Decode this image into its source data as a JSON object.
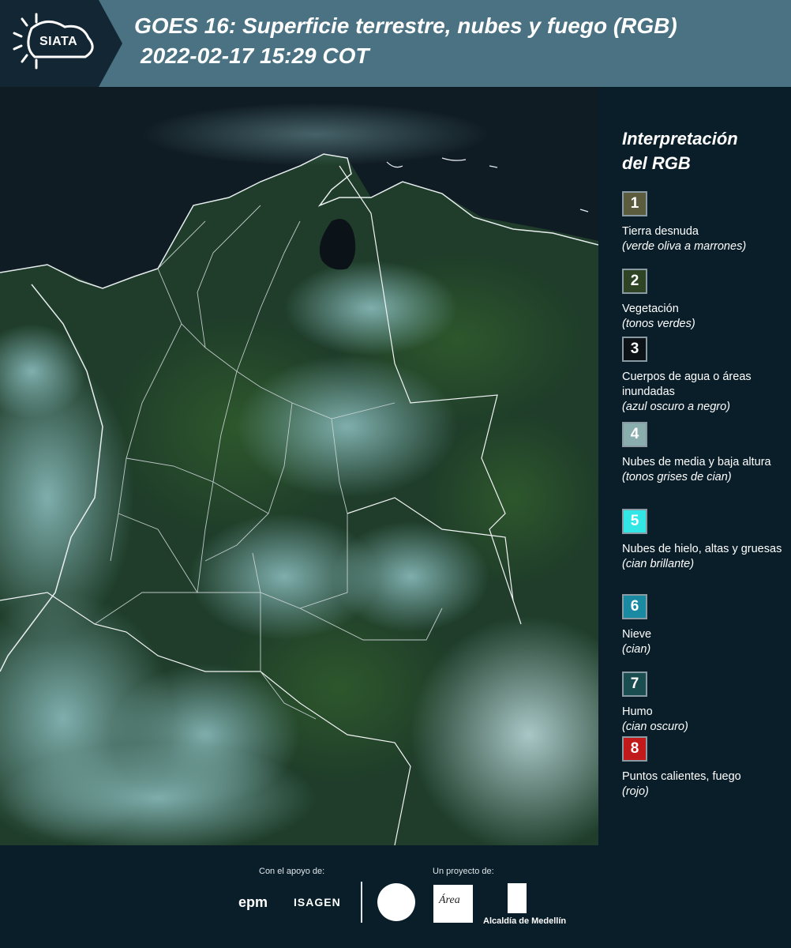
{
  "header": {
    "logo_text": "SIATA",
    "title_line1": "GOES 16: Superficie terrestre, nubes y fuego (RGB)",
    "title_line2": "2022-02-17 15:29 COT"
  },
  "legend": {
    "title_line1": "Interpretación",
    "title_line2": "del RGB",
    "items": [
      {
        "number": "1",
        "label": "Tierra desnuda",
        "note": "(verde oliva a marrones)",
        "color": "#5b5b3e"
      },
      {
        "number": "2",
        "label": "Vegetación",
        "note": "(tonos verdes)",
        "color": "#2e4424"
      },
      {
        "number": "3",
        "label": "Cuerpos de agua o áreas inundadas",
        "note": "(azul oscuro a negro)",
        "color": "#0d1216"
      },
      {
        "number": "4",
        "label": "Nubes de media y baja altura",
        "note": "(tonos grises de cian)",
        "color": "#8aaeae"
      },
      {
        "number": "5",
        "label": "Nubes de hielo, altas y gruesas",
        "note": "(cian brillante)",
        "color": "#33e6e6"
      },
      {
        "number": "6",
        "label": "Nieve",
        "note": "(cian)",
        "color": "#1a8aa2"
      },
      {
        "number": "7",
        "label": "Humo",
        "note": "(cian oscuro)",
        "color": "#1a4d50"
      },
      {
        "number": "8",
        "label": "Puntos calientes, fuego",
        "note": "(rojo)",
        "color": "#c01a1a"
      }
    ]
  },
  "footer": {
    "support_label": "Con el apoyo de:",
    "project_label": "Un proyecto de:",
    "sponsor1": "epm",
    "sponsor2": "ISAGEN",
    "area_text": "Área",
    "alcaldia": "Alcaldía de Medellín"
  }
}
